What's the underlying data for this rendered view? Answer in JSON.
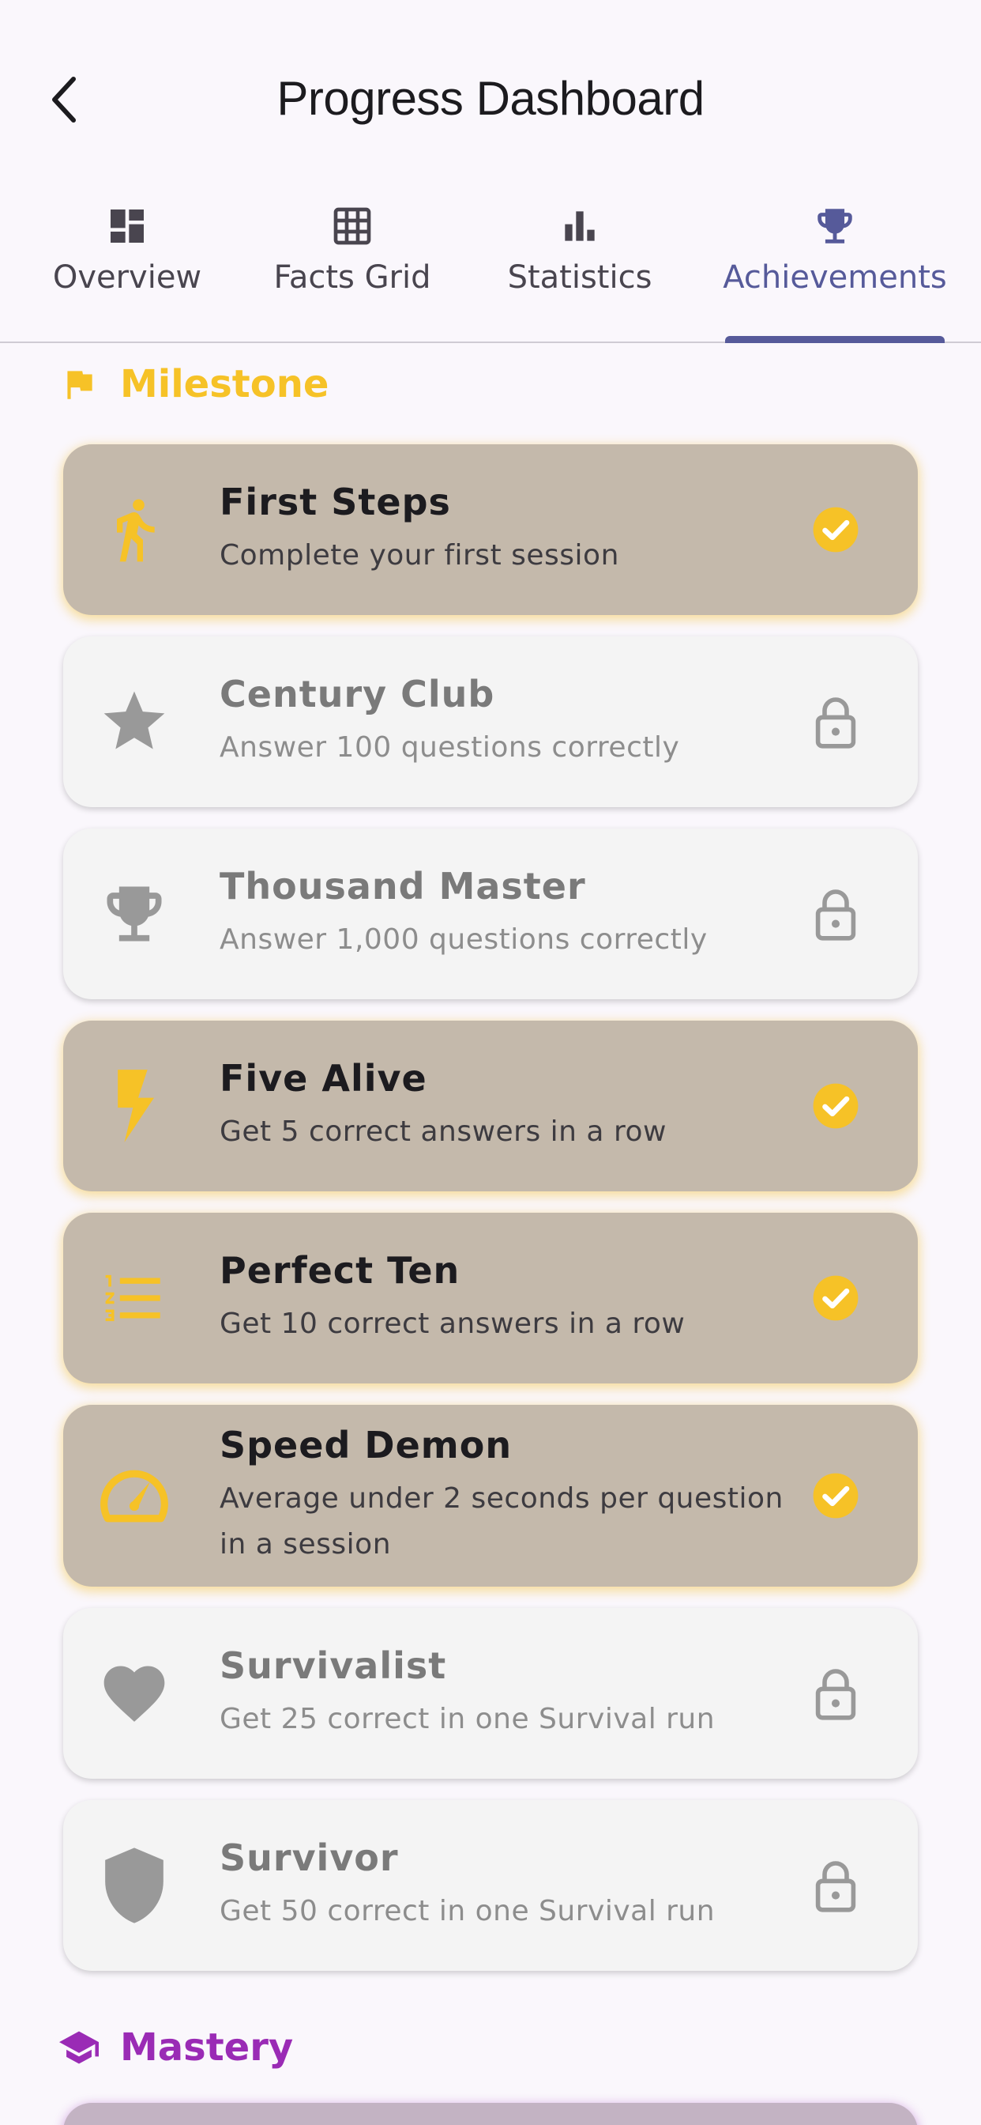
{
  "header": {
    "title": "Progress Dashboard"
  },
  "tabs": [
    {
      "label": "Overview",
      "icon": "dashboard-icon"
    },
    {
      "label": "Facts Grid",
      "icon": "grid-icon"
    },
    {
      "label": "Statistics",
      "icon": "bar-chart-icon"
    },
    {
      "label": "Achievements",
      "icon": "trophy-icon",
      "active": true
    }
  ],
  "sections": {
    "milestone": {
      "label": "Milestone",
      "icon": "flag-icon",
      "color": "#f6c227"
    },
    "mastery": {
      "label": "Mastery",
      "icon": "school-icon",
      "color": "#9a2bb5"
    }
  },
  "achievements": [
    {
      "title": "First Steps",
      "description": "Complete your first session",
      "icon": "walk-icon",
      "unlocked": true
    },
    {
      "title": "Century Club",
      "description": "Answer 100 questions correctly",
      "icon": "star-icon",
      "unlocked": false
    },
    {
      "title": "Thousand Master",
      "description": "Answer 1,000 questions correctly",
      "icon": "trophy-icon",
      "unlocked": false
    },
    {
      "title": "Five Alive",
      "description": "Get 5 correct answers in a row",
      "icon": "bolt-icon",
      "unlocked": true
    },
    {
      "title": "Perfect Ten",
      "description": "Get 10 correct answers in a row",
      "icon": "numbered-list-icon",
      "unlocked": true
    },
    {
      "title": "Speed Demon",
      "description": "Average under 2 seconds per question in a session",
      "icon": "speedometer-icon",
      "unlocked": true
    },
    {
      "title": "Survivalist",
      "description": "Get 25 correct in one Survival run",
      "icon": "heart-icon",
      "unlocked": false
    },
    {
      "title": "Survivor",
      "description": "Get 50 correct in one Survival run",
      "icon": "shield-icon",
      "unlocked": false
    }
  ],
  "colors": {
    "accent": "#565a9a",
    "gold": "#f6c227",
    "unlocked_card": "#c4b9ab",
    "locked_card": "#f4f4f4",
    "locked_icon": "#999999"
  }
}
